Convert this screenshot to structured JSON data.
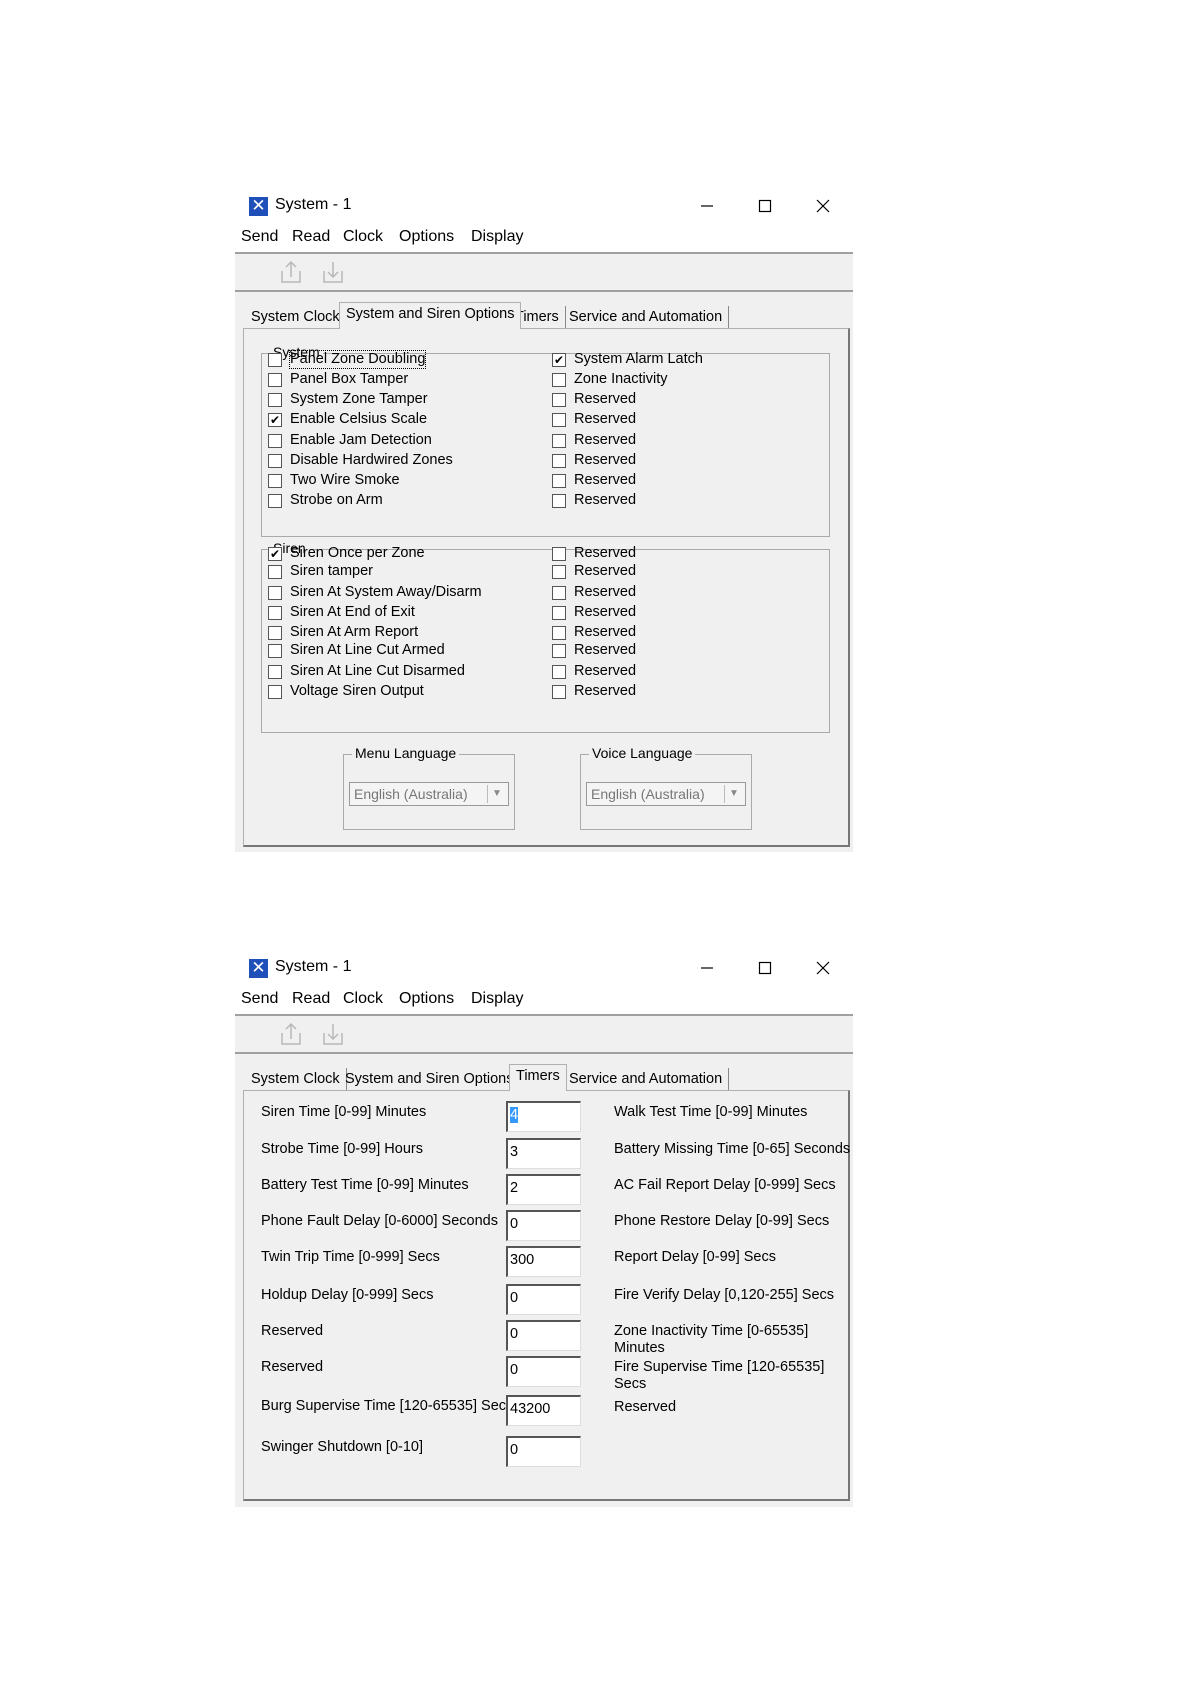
{
  "window1": {
    "title": "System - 1",
    "menu": [
      "Send",
      "Read",
      "Clock",
      "Options",
      "Display"
    ],
    "tabs": [
      "System Clock",
      "System and Siren Options",
      "Timers",
      "Service and Automation"
    ],
    "active_tab": "System and Siren Options",
    "system_group": {
      "label": "System",
      "left": [
        {
          "label": "Panel Zone Doubling",
          "checked": false
        },
        {
          "label": "Panel Box Tamper",
          "checked": false
        },
        {
          "label": "System Zone Tamper",
          "checked": false
        },
        {
          "label": "Enable Celsius Scale",
          "checked": true
        },
        {
          "label": "Enable Jam Detection",
          "checked": false
        },
        {
          "label": "Disable Hardwired Zones",
          "checked": false
        },
        {
          "label": "Two Wire Smoke",
          "checked": false
        },
        {
          "label": "Strobe on Arm",
          "checked": false
        }
      ],
      "right": [
        {
          "label": "System Alarm Latch",
          "checked": true
        },
        {
          "label": "Zone Inactivity",
          "checked": false
        },
        {
          "label": "Reserved",
          "checked": false
        },
        {
          "label": "Reserved",
          "checked": false
        },
        {
          "label": "Reserved",
          "checked": false
        },
        {
          "label": "Reserved",
          "checked": false
        },
        {
          "label": "Reserved",
          "checked": false
        },
        {
          "label": "Reserved",
          "checked": false
        }
      ]
    },
    "siren_group": {
      "label": "Siren",
      "left": [
        {
          "label": "Siren Once per Zone",
          "checked": true
        },
        {
          "label": "Siren tamper",
          "checked": false
        },
        {
          "label": "Siren At System Away/Disarm",
          "checked": false
        },
        {
          "label": "Siren At End of Exit",
          "checked": false
        },
        {
          "label": "Siren At Arm Report",
          "checked": false
        },
        {
          "label": "Siren At Line Cut Armed",
          "checked": false
        },
        {
          "label": "Siren At Line Cut Disarmed",
          "checked": false
        },
        {
          "label": "Voltage Siren Output",
          "checked": false
        }
      ],
      "right": [
        {
          "label": "Reserved",
          "checked": false
        },
        {
          "label": "Reserved",
          "checked": false
        },
        {
          "label": "Reserved",
          "checked": false
        },
        {
          "label": "Reserved",
          "checked": false
        },
        {
          "label": "Reserved",
          "checked": false
        },
        {
          "label": "Reserved",
          "checked": false
        },
        {
          "label": "Reserved",
          "checked": false
        },
        {
          "label": "Reserved",
          "checked": false
        }
      ]
    },
    "menu_language": {
      "label": "Menu Language",
      "value": "English (Australia)"
    },
    "voice_language": {
      "label": "Voice Language",
      "value": "English (Australia)"
    }
  },
  "window2": {
    "title": "System - 1",
    "menu": [
      "Send",
      "Read",
      "Clock",
      "Options",
      "Display"
    ],
    "tabs": [
      "System Clock",
      "System and Siren Options",
      "Timers",
      "Service and Automation"
    ],
    "active_tab": "Timers",
    "timers_left": [
      {
        "label": "Siren Time [0-99] Minutes",
        "value": "4"
      },
      {
        "label": "Strobe Time [0-99] Hours",
        "value": "3"
      },
      {
        "label": "Battery Test Time [0-99] Minutes",
        "value": "2"
      },
      {
        "label": "Phone Fault Delay [0-6000] Seconds",
        "value": "0"
      },
      {
        "label": "Twin Trip Time [0-999] Secs",
        "value": "300"
      },
      {
        "label": "Holdup Delay [0-999] Secs",
        "value": "0"
      },
      {
        "label": "Reserved",
        "value": "0"
      },
      {
        "label": "Reserved",
        "value": "0"
      },
      {
        "label": "Burg Supervise Time [120-65535] Sec",
        "value": "43200"
      },
      {
        "label": "Swinger Shutdown [0-10]",
        "value": "0"
      }
    ],
    "timers_right": [
      {
        "line1": "Walk Test Time [0-99] Minutes",
        "line2": ""
      },
      {
        "line1": "Battery Missing Time [0-65] Seconds",
        "line2": ""
      },
      {
        "line1": "AC Fail Report Delay [0-999] Secs",
        "line2": ""
      },
      {
        "line1": "Phone Restore Delay [0-99] Secs",
        "line2": ""
      },
      {
        "line1": "Report Delay [0-99] Secs",
        "line2": ""
      },
      {
        "line1": "Fire Verify Delay [0,120-255] Secs",
        "line2": ""
      },
      {
        "line1": "Zone Inactivity Time [0-65535]",
        "line2": "Minutes"
      },
      {
        "line1": "Fire Supervise Time [120-65535]",
        "line2": "Secs"
      },
      {
        "line1": "Reserved",
        "line2": ""
      }
    ]
  }
}
